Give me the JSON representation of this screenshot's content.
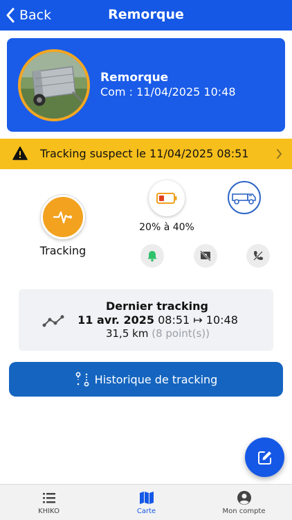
{
  "header": {
    "back_label": "Back",
    "title": "Remorque"
  },
  "vehicle": {
    "name": "Remorque",
    "com": "Com : 11/04/2025 10:48",
    "photo_ring_color": "#f4a623"
  },
  "alert": {
    "text": "Tracking suspect le 11/04/2025 08:51",
    "color": "#f7bf1c"
  },
  "status": {
    "tracking_label": "Tracking",
    "battery_label": "20% à 40%",
    "tracking_color": "#f3a220",
    "battery_color": "#f0a020"
  },
  "last_tracking": {
    "title": "Dernier tracking",
    "date": "11 avr. 2025",
    "times": "08:51 ↦ 10:48",
    "distance": "31,5 km",
    "points": "(8 point(s))"
  },
  "history_button": {
    "label": "Historique de tracking"
  },
  "bottom_nav": {
    "items": [
      {
        "label": "KHIKO",
        "icon": "list-icon"
      },
      {
        "label": "Carte",
        "icon": "map-icon",
        "active": true
      },
      {
        "label": "Mon compte",
        "icon": "account-icon"
      }
    ]
  },
  "colors": {
    "primary": "#1558e6",
    "button": "#1565c0",
    "bell_green": "#2ec36b"
  }
}
